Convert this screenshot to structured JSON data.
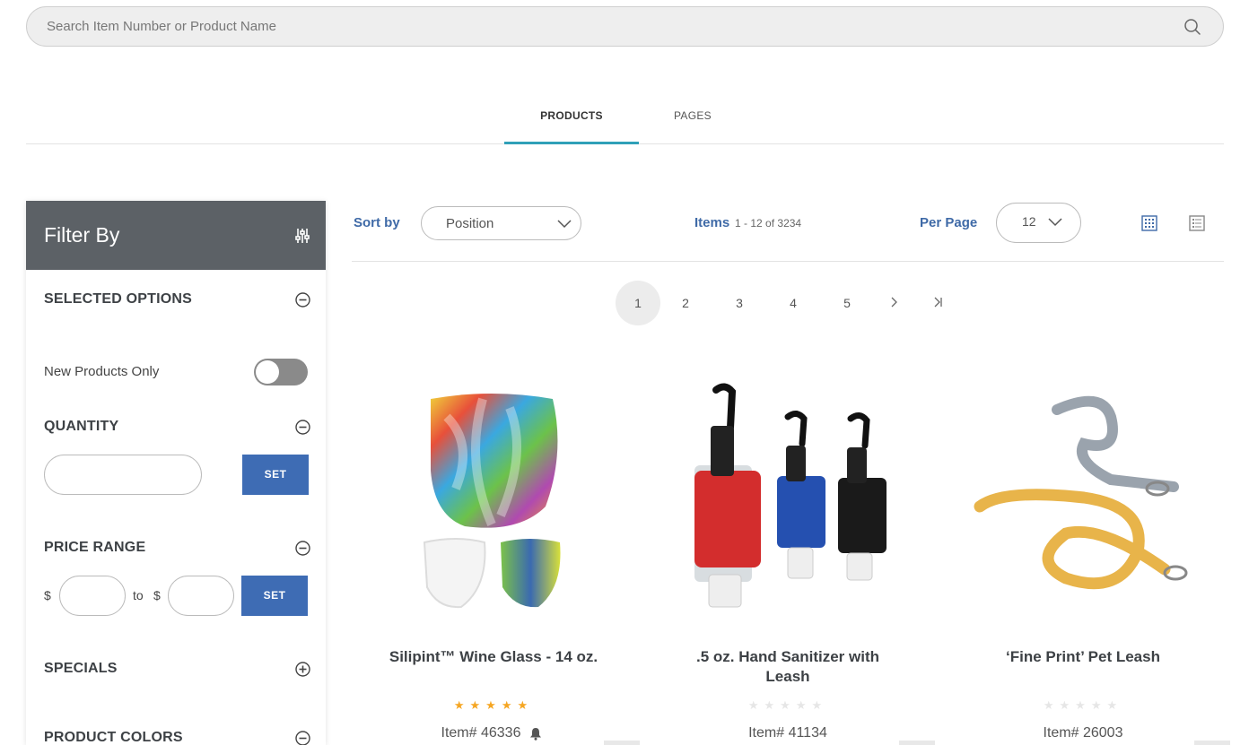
{
  "search": {
    "placeholder": "Search Item Number or Product Name",
    "icon": "search-icon"
  },
  "tabs": [
    {
      "label": "PRODUCTS",
      "active": true
    },
    {
      "label": "PAGES",
      "active": false
    }
  ],
  "sidebar": {
    "title": "Filter By",
    "sections": {
      "selected_options": "SELECTED OPTIONS",
      "new_products_label": "New Products Only",
      "new_products_enabled": false,
      "quantity": "QUANTITY",
      "quantity_set": "SET",
      "price_range": "PRICE RANGE",
      "price_currency": "$",
      "price_to": "to",
      "price_set": "SET",
      "specials": "SPECIALS",
      "product_colors": "PRODUCT COLORS"
    }
  },
  "toolbar": {
    "sort_label": "Sort by",
    "sort_value": "Position",
    "items_label": "Items",
    "items_range": "1 - 12",
    "items_of": "of",
    "items_total": "3234",
    "per_page_label": "Per Page",
    "per_page_value": "12",
    "view_mode": "grid"
  },
  "pagination": {
    "pages": [
      "1",
      "2",
      "3",
      "4",
      "5"
    ],
    "current": "1"
  },
  "products": [
    {
      "name": "Silipint™ Wine Glass - 14 oz.",
      "rating": 5,
      "item": "Item# 46336",
      "bell": true
    },
    {
      "name": ".5 oz. Hand Sanitizer with Leash",
      "rating": 0,
      "item": "Item# 41134",
      "bell": false
    },
    {
      "name": "‘Fine Print’ Pet Leash",
      "rating": 0,
      "item": "Item# 26003",
      "bell": false
    }
  ],
  "colors": {
    "accent_blue": "#3f6aa7",
    "button_blue": "#3e6cb4",
    "tab_underline": "#2fa0b8",
    "header_gray": "#5c6166",
    "star": "#f5a623"
  }
}
